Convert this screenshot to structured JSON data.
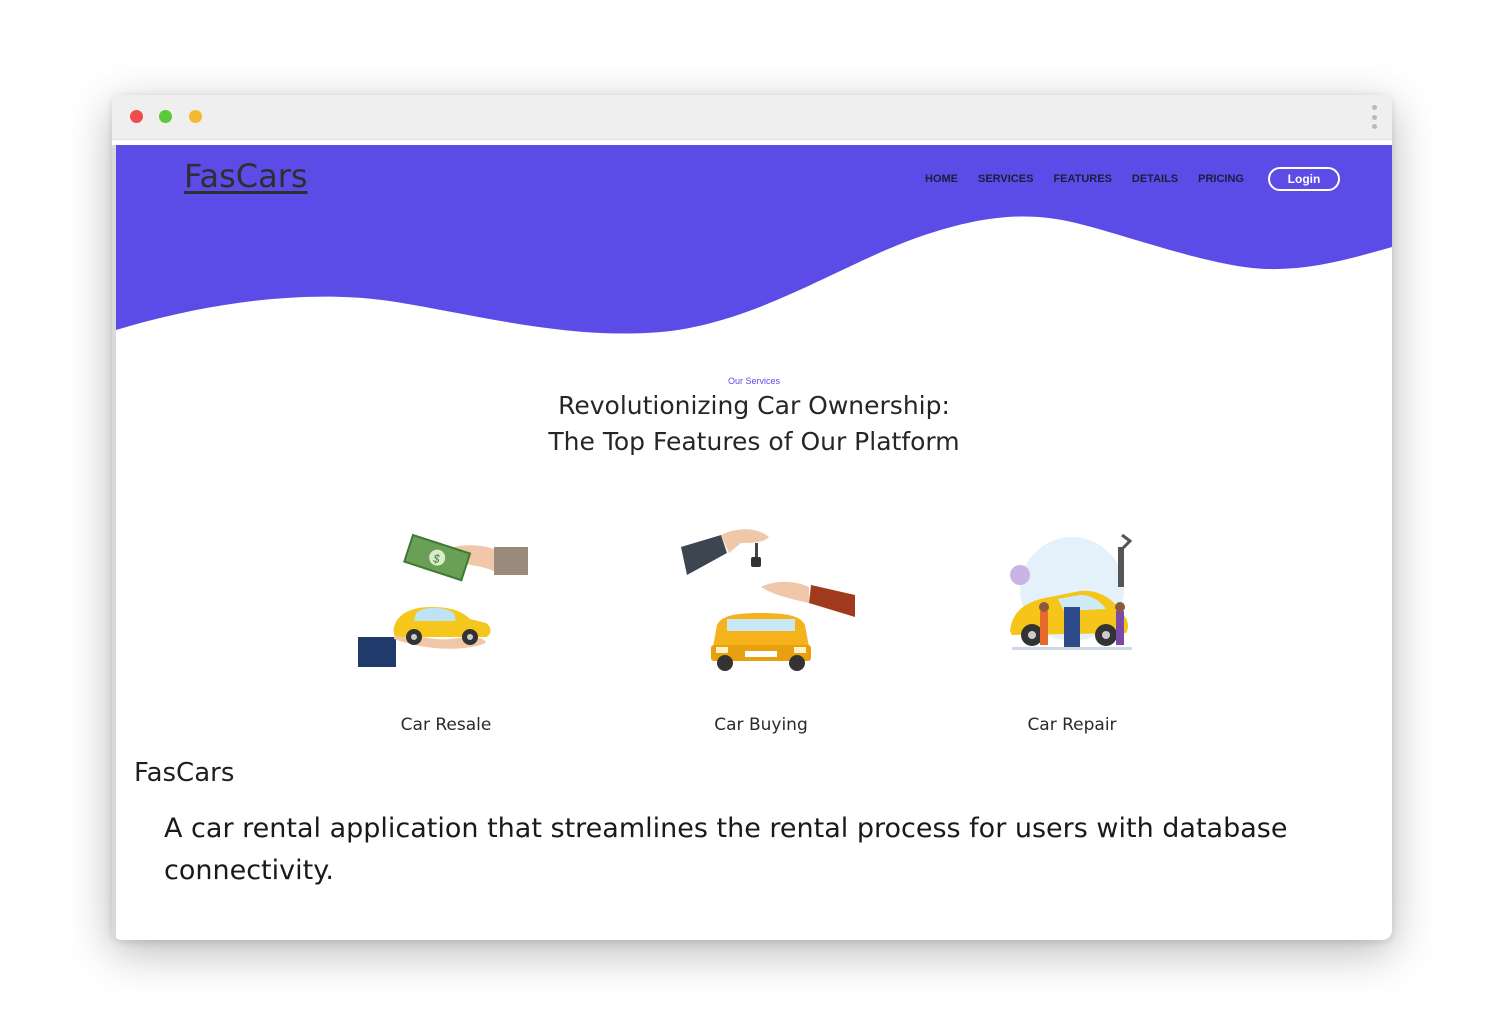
{
  "browser": {
    "window_controls": [
      "close",
      "minimize",
      "maximize"
    ],
    "menu_icon": "kebab-menu-icon"
  },
  "header": {
    "logo": "FasCars",
    "nav": [
      "HOME",
      "SERVICES",
      "FEATURES",
      "DETAILS",
      "PRICING"
    ],
    "login_label": "Login",
    "brand_color": "#5b4ce8"
  },
  "services": {
    "eyebrow": "Our Services",
    "headline_line1": "Revolutionizing Car Ownership:",
    "headline_line2": "The Top Features of Our Platform",
    "items": [
      {
        "label": "Car Resale",
        "icon": "car-resale-illustration"
      },
      {
        "label": "Car Buying",
        "icon": "car-buying-illustration"
      },
      {
        "label": "Car Repair",
        "icon": "car-repair-illustration"
      }
    ]
  },
  "about": {
    "title": "FasCars",
    "description": "A car rental application that streamlines the rental process for users with database connectivity."
  }
}
